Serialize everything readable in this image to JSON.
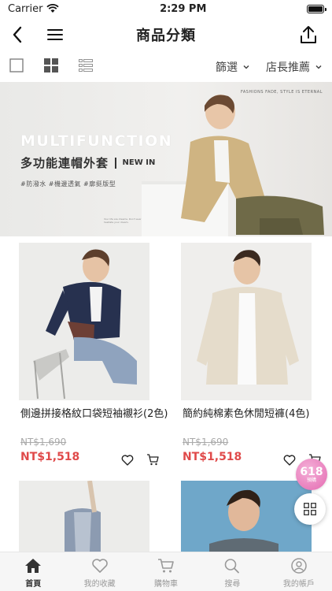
{
  "status_bar": {
    "carrier": "Carrier",
    "time": "2:29 PM"
  },
  "nav": {
    "title": "商品分類"
  },
  "toolbar": {
    "filter_label": "篩選",
    "sort_label": "店長推薦"
  },
  "banner": {
    "headline": "MULTIFUNCTION",
    "title_cn": "多功能連帽外套",
    "new_in": "NEW IN",
    "tags": "#防潑水 #機邊透氣 #廓挺版型",
    "slogan": "FASHIONS FADE, STYLE IS ETERNAL",
    "small_copy": "Your life are dreams. Don't ever hesitate your dream."
  },
  "products": [
    {
      "name": "側邊拼接格紋口袋短袖襯衫(2色)",
      "old_price": "NT$1,690",
      "price": "NT$1,518"
    },
    {
      "name": "簡約純棉素色休閒短褲(4色)",
      "old_price": "NT$1,690",
      "price": "NT$1,518"
    },
    {
      "name": "",
      "old_price": "",
      "price": ""
    },
    {
      "name": "",
      "old_price": "",
      "price": ""
    }
  ],
  "badge": {
    "big": "618",
    "small": "預購"
  },
  "tabs": [
    {
      "label": "首頁",
      "icon": "home-icon",
      "active": true
    },
    {
      "label": "我的收藏",
      "icon": "heart-icon",
      "active": false
    },
    {
      "label": "購物車",
      "icon": "cart-icon",
      "active": false
    },
    {
      "label": "搜尋",
      "icon": "search-icon",
      "active": false
    },
    {
      "label": "我的帳戶",
      "icon": "account-icon",
      "active": false
    }
  ],
  "colors": {
    "price": "#e04a4a",
    "badge": "#e46ab1",
    "tab_active": "#333333",
    "tab_inactive": "#999999"
  }
}
